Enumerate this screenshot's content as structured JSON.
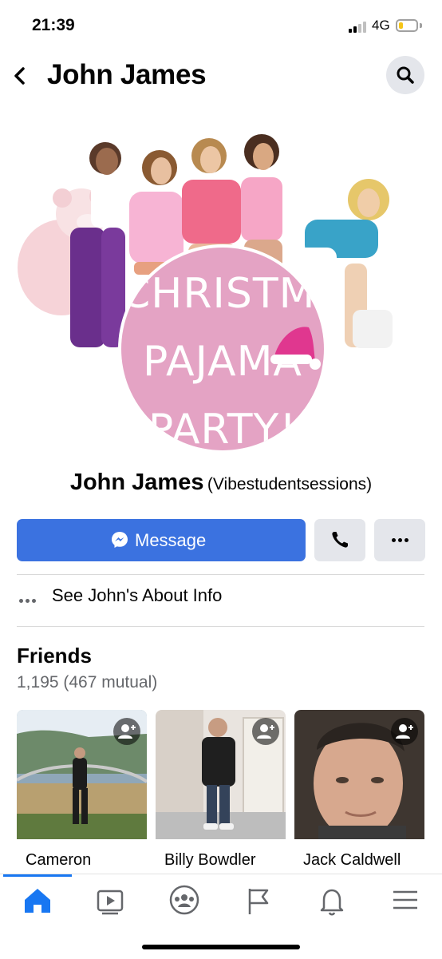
{
  "status_bar": {
    "time": "21:39",
    "network": "4G"
  },
  "header": {
    "title": "John James",
    "back_icon": "chevron-left-icon",
    "search_icon": "search-icon"
  },
  "profile": {
    "picture_text": [
      "CHRISTMAS",
      "PAJAMA",
      "PARTY!"
    ],
    "name": "John James",
    "username": "(Vibestudentsessions)"
  },
  "actions": {
    "message_label": "Message",
    "call_icon": "phone-icon",
    "more_icon": "more-icon"
  },
  "about": {
    "label": "See John's About Info"
  },
  "friends": {
    "title": "Friends",
    "count": "1,195 (467 mutual)",
    "items": [
      {
        "name": "Cameron"
      },
      {
        "name": "Billy Bowdler"
      },
      {
        "name": "Jack Caldwell"
      }
    ]
  },
  "tabs": [
    "home-icon",
    "watch-icon",
    "groups-icon",
    "pages-icon",
    "notifications-icon",
    "menu-icon"
  ],
  "colors": {
    "accent": "#1877f2",
    "message_button": "#3b72e0",
    "secondary_button": "#e4e6eb",
    "profile_pink": "#e4a3c4"
  }
}
